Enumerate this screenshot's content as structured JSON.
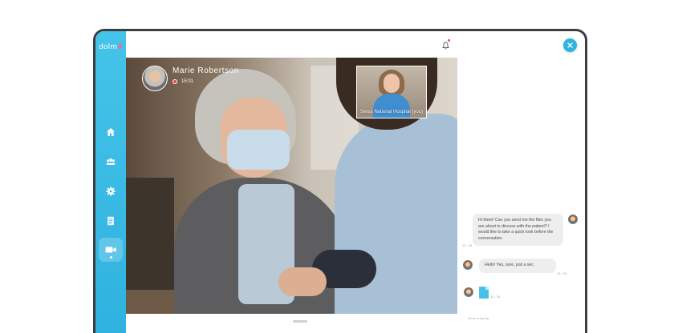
{
  "app": {
    "logo_text": "dolm",
    "logo_accent": "X"
  },
  "colors": {
    "sidebar": "#2fb2df",
    "accent": "#2db5de",
    "recording": "#e8434d",
    "bubble": "#eeeeef"
  },
  "sidebar": {
    "items": [
      {
        "name": "home",
        "icon": "home-icon"
      },
      {
        "name": "patients",
        "icon": "users-icon"
      },
      {
        "name": "settings",
        "icon": "gear-icon"
      },
      {
        "name": "documents",
        "icon": "document-icon"
      },
      {
        "name": "video-call",
        "icon": "video-camera-icon",
        "active": true
      }
    ]
  },
  "call": {
    "caller_name": "Marie Robertson",
    "timer": "15:01",
    "self_view_label": "Swiss National Hospital (you)"
  },
  "chat": {
    "messages": [
      {
        "from": "other",
        "text": "Hi there! Can you send me the files you are about to discuss with the patient? I would like to take a quick look before the conversation.",
        "time": "12 : 15"
      },
      {
        "from": "me",
        "text": "Hello! Yes, sure, just a sec.",
        "time": "12 : 15"
      },
      {
        "from": "me",
        "file": true,
        "time": "12 : 15"
      }
    ],
    "typing_indicator": "Marie is typing"
  }
}
